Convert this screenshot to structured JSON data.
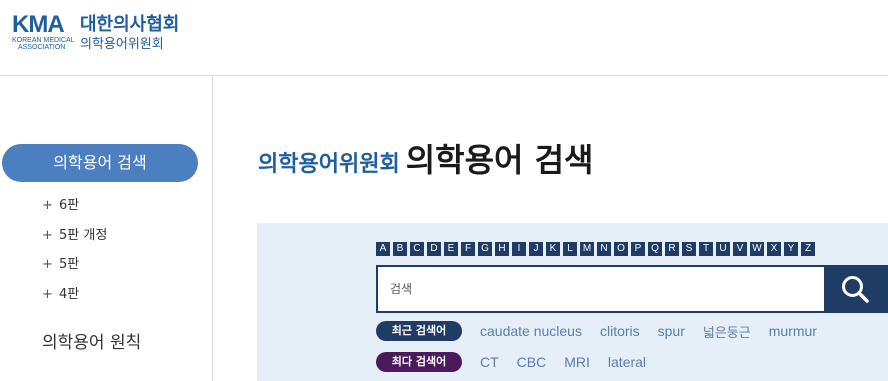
{
  "header": {
    "logo_mark": "KMA",
    "logo_sub_line1": "KOREAN MEDICAL",
    "logo_sub_line2": "ASSOCIATION",
    "org_name": "대한의사협회",
    "committee_name": "의학용어위원회"
  },
  "sidebar": {
    "active_label": "의학용어 검색",
    "items": [
      {
        "label": "6판"
      },
      {
        "label": "5판 개정"
      },
      {
        "label": "5판"
      },
      {
        "label": "4판"
      }
    ],
    "item_prefix": "+",
    "section_label": "의학용어 원칙"
  },
  "main": {
    "title_prefix": "의학용어위원회",
    "title": "의학용어 검색"
  },
  "search": {
    "alphabet": [
      "A",
      "B",
      "C",
      "D",
      "E",
      "F",
      "G",
      "H",
      "I",
      "J",
      "K",
      "L",
      "M",
      "N",
      "O",
      "P",
      "Q",
      "R",
      "S",
      "T",
      "U",
      "V",
      "W",
      "X",
      "Y",
      "Z"
    ],
    "placeholder": "검색",
    "recent_label": "최근 검색어",
    "recent_keywords": [
      "caudate nucleus",
      "clitoris",
      "spur",
      "넓은둥근",
      "murmur"
    ],
    "most_label": "최다 검색어",
    "most_keywords": [
      "CT",
      "CBC",
      "MRI",
      "lateral"
    ]
  },
  "colors": {
    "brand_blue": "#1f5fa0",
    "navy": "#1f3c64",
    "sidebar_active": "#4b7fbf",
    "panel_bg": "#e6eef8",
    "most_badge": "#4a1a5c",
    "keyword_text": "#5b7fa8"
  }
}
